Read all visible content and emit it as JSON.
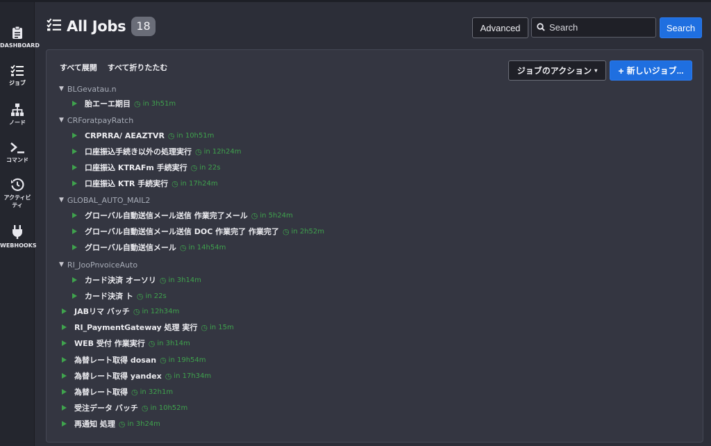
{
  "sidebar": {
    "items": [
      {
        "label": "DASHBOARD",
        "icon": "clipboard-icon"
      },
      {
        "label": "ジョブ",
        "icon": "checklist-icon"
      },
      {
        "label": "ノード",
        "icon": "sitemap-icon"
      },
      {
        "label": "コマンド",
        "icon": "terminal-icon"
      },
      {
        "label": "アクティビティ",
        "icon": "history-icon"
      },
      {
        "label": "WEBHOOKS",
        "icon": "plug-icon"
      }
    ]
  },
  "header": {
    "title": "All Jobs",
    "count": "18",
    "advanced_label": "Advanced",
    "search_placeholder": "Search",
    "search_button": "Search"
  },
  "panel": {
    "expand_all": "すべて展開",
    "collapse_all": "すべて折りたたむ",
    "actions_label": "ジョブのアクション",
    "new_job_label": "新しいジョブ..."
  },
  "tree": [
    {
      "type": "group",
      "name": "BLGevatau.n"
    },
    {
      "type": "job",
      "name": "胎エーエ期目",
      "schedule": "in 3h51m"
    },
    {
      "type": "group",
      "name": "CRForatpayRatch"
    },
    {
      "type": "job",
      "name": "CRPRRA/ AEAZTVR",
      "schedule": "in 10h51m"
    },
    {
      "type": "job",
      "name": "口座振込手続き以外の処理実行",
      "schedule": "in 12h24m"
    },
    {
      "type": "job",
      "name": "口座振込 KTRAFm 手続実行",
      "schedule": "in 22s"
    },
    {
      "type": "job",
      "name": "口座振込 KTR 手続実行",
      "schedule": "in 17h24m"
    },
    {
      "type": "group",
      "name": "GLOBAL_AUTO_MAIL2"
    },
    {
      "type": "job",
      "name": "グローバル自動送信メール送信 作業完了メール",
      "schedule": "in 5h24m"
    },
    {
      "type": "job",
      "name": "グローバル自動送信メール送信 DOC 作業完了 作業完了",
      "schedule": "in 2h52m"
    },
    {
      "type": "job",
      "name": "グローバル自動送信メール",
      "schedule": "in 14h54m"
    },
    {
      "type": "group",
      "name": "RI_JooPnvoiceAuto"
    },
    {
      "type": "job",
      "name": "カード決済 オーソリ",
      "schedule": "in 3h14m"
    },
    {
      "type": "job",
      "name": "カード決済 ト",
      "schedule": "in 22s"
    },
    {
      "type": "job",
      "name": "JABリマ バッチ",
      "schedule": "in 12h34m"
    },
    {
      "type": "job",
      "name": "RI_PaymentGateway 処理 実行",
      "schedule": "in 15m"
    },
    {
      "type": "job",
      "name": "WEB 受付 作業実行",
      "schedule": "in 3h14m"
    },
    {
      "type": "job",
      "name": "為替レート取得 dosan",
      "schedule": "in 19h54m"
    },
    {
      "type": "job",
      "name": "為替レート取得 yandex",
      "schedule": "in 17h34m"
    },
    {
      "type": "job",
      "name": "為替レート取得",
      "schedule": "in 32h1m"
    },
    {
      "type": "job",
      "name": "受注データ バッチ",
      "schedule": "in 10h52m"
    },
    {
      "type": "job",
      "name": "再通知 処理",
      "schedule": "in 3h24m"
    }
  ],
  "colors": {
    "accent_blue": "#1f6fe0",
    "schedule_green": "#3fa34d",
    "background": "#2c2e38"
  }
}
